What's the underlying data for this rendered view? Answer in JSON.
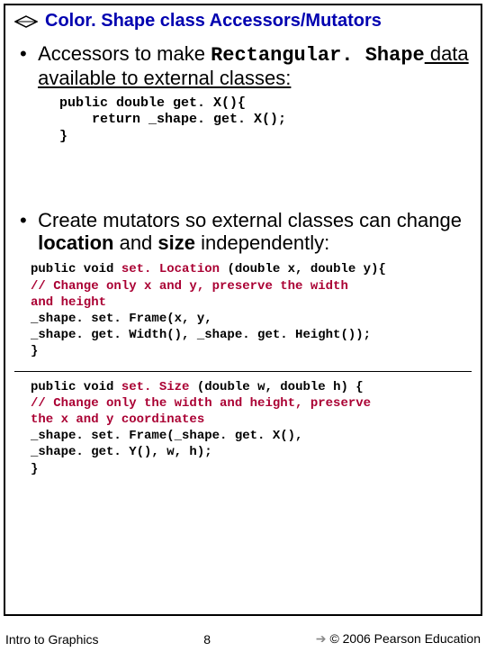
{
  "title": "Color. Shape class Accessors/Mutators",
  "bullet1": {
    "pre": "Accessors to make ",
    "mono": "Rectangular. Shape",
    "post": " data available to external classes:"
  },
  "code1": {
    "l1": "public double get. X(){",
    "l2": "    return _shape. get. X();",
    "l3": "}"
  },
  "bullet2": {
    "pre": "Create mutators so external classes can change ",
    "b1": "location",
    "mid": " and ",
    "b2": "size",
    "post": " independently:"
  },
  "code2": {
    "l1a": "public void ",
    "l1b": "set. Location",
    "l1c": " (double x, double y){",
    "l2": "   // Change only x and y, preserve the width",
    "l3": "      and height",
    "l4": "   _shape. set. Frame(x, y,",
    "l5": "           _shape. get. Width(), _shape. get. Height());",
    "l6": "}"
  },
  "code3": {
    "l1a": "public void ",
    "l1b": "set. Size",
    "l1c": " (double w, double h) {",
    "l2": "   // Change only the width and height, preserve",
    "l3": "      the x and y coordinates",
    "l4": "  _shape. set. Frame(_shape. get. X(),",
    "l5": "                 _shape. get. Y(), w, h);",
    "l6": "}"
  },
  "footer": {
    "left": "Intro to Graphics",
    "center": "8",
    "right": "© 2006 Pearson Education"
  }
}
